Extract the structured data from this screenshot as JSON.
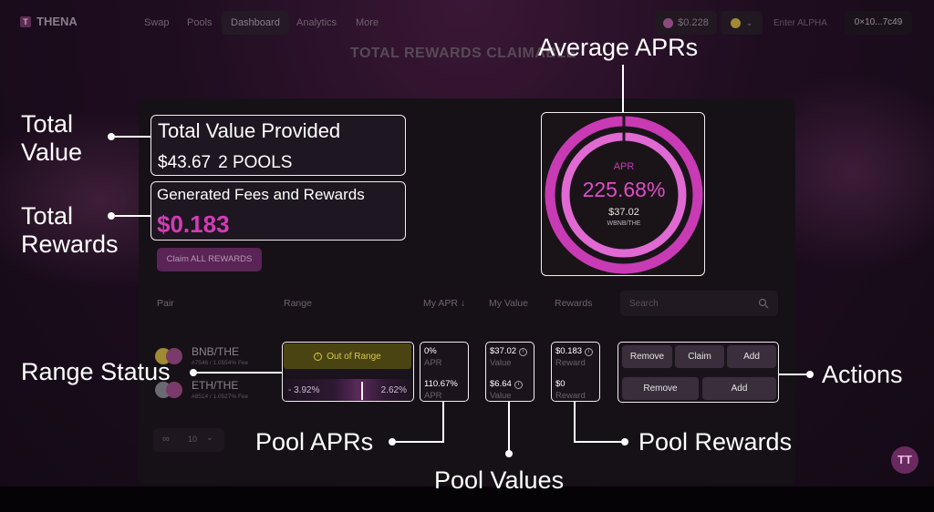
{
  "nav": {
    "brand": "THENA",
    "items": [
      "Swap",
      "Pools",
      "Dashboard",
      "Analytics",
      "More"
    ],
    "active_item": "Dashboard",
    "price": "$0.228",
    "alpha_placeholder": "Enter ALPHA",
    "wallet": "0×10...7c49"
  },
  "faded_heading": "TOTAL REWARDS CLAIMABLE",
  "summary": {
    "total_value_title": "Total Value Provided",
    "total_value": "$43.67",
    "pools_count": "2 POOLS",
    "fees_title": "Generated Fees and Rewards",
    "fees_value": "$0.183",
    "claim_all": "Claim ALL REWARDS"
  },
  "apr_card": {
    "label": "APR",
    "value": "225.68%",
    "amount": "$37.02",
    "pair": "WBNB/THE",
    "colors": {
      "accent": "#d43bb8",
      "ring_outer": "#c93ab5",
      "ring_inner": "#e06ad2"
    }
  },
  "table": {
    "headers": {
      "pair": "Pair",
      "range": "Range",
      "my_apr": "My APR",
      "sort_icon": "↓",
      "my_value": "My Value",
      "rewards": "Rewards"
    },
    "search_placeholder": "Search"
  },
  "pairs": [
    {
      "name": "BNB/THE",
      "sub": "#7546 / 1.0554% Fee"
    },
    {
      "name": "ETH/THE",
      "sub": "#8514 / 1.0527% Fee"
    }
  ],
  "range": {
    "status": "Out of Range",
    "min": "- 3.92%",
    "max": "2.62%"
  },
  "apr_stats": [
    {
      "value": "0%",
      "label": "APR"
    },
    {
      "value": "110.67%",
      "label": "APR"
    }
  ],
  "value_stats": [
    {
      "value": "$37.02",
      "label": "Value"
    },
    {
      "value": "$6.64",
      "label": "Value"
    }
  ],
  "reward_stats": [
    {
      "value": "$0.183",
      "label": "Reward"
    },
    {
      "value": "$0",
      "label": "Reward"
    }
  ],
  "actions": {
    "row1": [
      "Remove",
      "Claim",
      "Add"
    ],
    "row2": [
      "Remove",
      "Add"
    ]
  },
  "pagination": {
    "page_size": "10"
  },
  "chat_fab": "TT",
  "annotations": {
    "total_value": [
      "Total",
      "Value"
    ],
    "total_rewards": [
      "Total",
      "Rewards"
    ],
    "average_aprs": "Average APRs",
    "range_status": "Range Status",
    "actions": "Actions",
    "pool_aprs": "Pool APRs",
    "pool_rewards": "Pool Rewards",
    "pool_values": "Pool Values"
  }
}
